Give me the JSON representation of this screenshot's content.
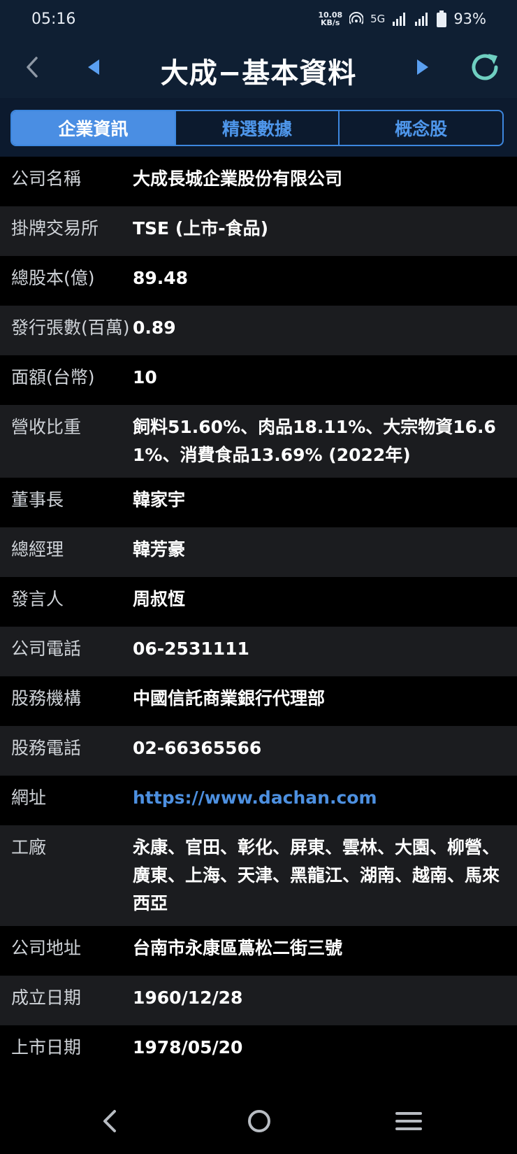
{
  "status_bar": {
    "time": "05:16",
    "net_speed_value": "10.08",
    "net_speed_unit": "KB/s",
    "network_type": "5G",
    "battery_percent": "93%"
  },
  "header": {
    "title": "大成−基本資料"
  },
  "tabs": [
    {
      "label": "企業資訊",
      "active": true
    },
    {
      "label": "精選數據",
      "active": false
    },
    {
      "label": "概念股",
      "active": false
    }
  ],
  "info_rows": [
    {
      "label": "公司名稱",
      "value": "大成長城企業股份有限公司"
    },
    {
      "label": "掛牌交易所",
      "value": "TSE (上市-食品)"
    },
    {
      "label": "總股本(億)",
      "value": "89.48"
    },
    {
      "label": "發行張數(百萬)",
      "value": "0.89"
    },
    {
      "label": "面額(台幣)",
      "value": "10"
    },
    {
      "label": "營收比重",
      "value": "飼料51.60%、肉品18.11%、大宗物資16.61%、消費食品13.69% (2022年)"
    },
    {
      "label": "董事長",
      "value": "韓家宇"
    },
    {
      "label": "總經理",
      "value": "韓芳豪"
    },
    {
      "label": "發言人",
      "value": "周叔恆"
    },
    {
      "label": "公司電話",
      "value": "06-2531111"
    },
    {
      "label": "股務機構",
      "value": "中國信託商業銀行代理部"
    },
    {
      "label": "股務電話",
      "value": "02-66365566"
    },
    {
      "label": "網址",
      "value": "https://www.dachan.com"
    },
    {
      "label": "工廠",
      "value": "永康、官田、彰化、屏東、雲林、大園、柳營、廣東、上海、天津、黑龍江、湖南、越南、馬來西亞"
    },
    {
      "label": "公司地址",
      "value": "台南市永康區蔦松二街三號"
    },
    {
      "label": "成立日期",
      "value": "1960/12/28"
    },
    {
      "label": "上市日期",
      "value": "1978/05/20"
    }
  ],
  "colors": {
    "header_bg": "#0f1f33",
    "accent_blue": "#4a8ee3",
    "refresh_teal": "#6fcfc1",
    "link_blue": "#4d90e0"
  },
  "icons": {
    "back": "chevron-left-icon",
    "prev": "triangle-left-icon",
    "next": "triangle-right-icon",
    "refresh": "refresh-icon"
  }
}
